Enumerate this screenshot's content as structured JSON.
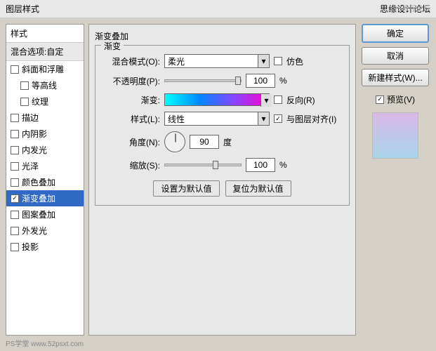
{
  "titleBar": {
    "left": "图层样式",
    "right": "思缘设计论坛"
  },
  "sidebar": {
    "header": "样式",
    "sub": "混合选项:自定",
    "items": [
      {
        "label": "斜面和浮雕",
        "indent": false,
        "checked": false
      },
      {
        "label": "等高线",
        "indent": true,
        "checked": false
      },
      {
        "label": "纹理",
        "indent": true,
        "checked": false
      },
      {
        "label": "描边",
        "indent": false,
        "checked": false
      },
      {
        "label": "内阴影",
        "indent": false,
        "checked": false
      },
      {
        "label": "内发光",
        "indent": false,
        "checked": false
      },
      {
        "label": "光泽",
        "indent": false,
        "checked": false
      },
      {
        "label": "颜色叠加",
        "indent": false,
        "checked": false
      },
      {
        "label": "渐变叠加",
        "indent": false,
        "checked": true,
        "active": true
      },
      {
        "label": "图案叠加",
        "indent": false,
        "checked": false
      },
      {
        "label": "外发光",
        "indent": false,
        "checked": false
      },
      {
        "label": "投影",
        "indent": false,
        "checked": false
      }
    ]
  },
  "content": {
    "title": "渐变叠加",
    "legend": "渐变",
    "blendMode": {
      "label": "混合模式(O):",
      "value": "柔光",
      "ditherLabel": "仿色"
    },
    "opacity": {
      "label": "不透明度(P):",
      "value": "100",
      "unit": "%"
    },
    "gradient": {
      "label": "渐变:",
      "reverseLabel": "反向(R)"
    },
    "style": {
      "label": "样式(L):",
      "value": "线性",
      "alignLabel": "与图层对齐(I)"
    },
    "angle": {
      "label": "角度(N):",
      "value": "90",
      "unit": "度"
    },
    "scale": {
      "label": "缩放(S):",
      "value": "100",
      "unit": "%"
    },
    "btnDefault": "设置为默认值",
    "btnReset": "复位为默认值"
  },
  "rightPanel": {
    "ok": "确定",
    "cancel": "取消",
    "newStyle": "新建样式(W)...",
    "previewLabel": "预览(V)"
  },
  "watermark": "PS学堂  www.52psxt.com",
  "wm2": "PS教程论坛"
}
